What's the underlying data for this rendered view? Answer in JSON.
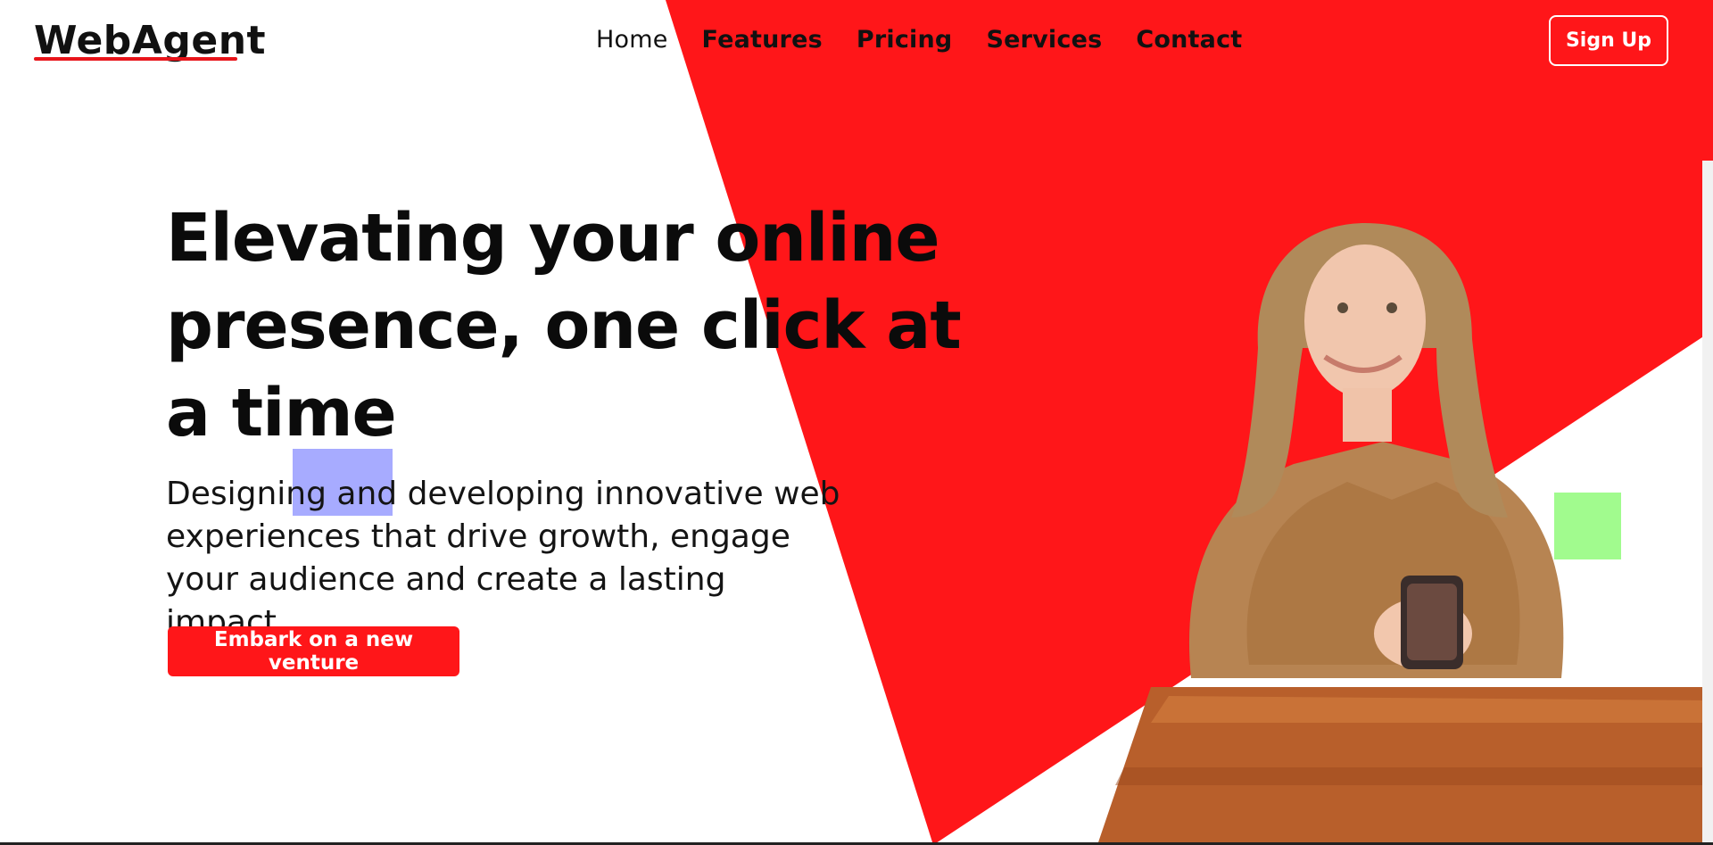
{
  "brand": {
    "name": "WebAgent",
    "accent_color": "#ff1619"
  },
  "nav": {
    "items": [
      {
        "label": "Home"
      },
      {
        "label": "Features"
      },
      {
        "label": "Pricing"
      },
      {
        "label": "Services"
      },
      {
        "label": "Contact"
      }
    ],
    "signup_label": "Sign Up"
  },
  "hero": {
    "title": "Elevating your online presence, one click at a time",
    "subtitle": "Designing and developing innovative web experiences that drive growth, engage your audience and create a lasting impact.",
    "cta_label": "Embark on a new venture"
  },
  "colors": {
    "red": "#ff1619",
    "highlight": "#a7abff",
    "green": "#a1fb8e"
  },
  "icons": {
    "photo": "woman-with-phone-image"
  }
}
